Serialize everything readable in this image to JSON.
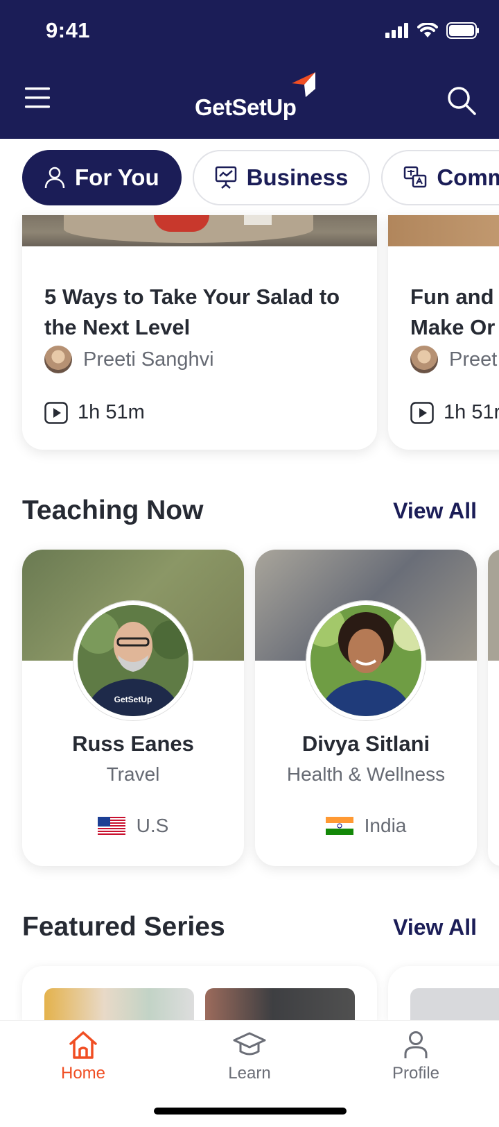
{
  "status_bar": {
    "time": "9:41"
  },
  "header": {
    "logo_text": "GetSetUp",
    "menu_icon": "hamburger-icon",
    "search_icon": "search-icon",
    "brand_color": "#1b1d57",
    "accent_color": "#f04e23"
  },
  "tabs": [
    {
      "label": "For You",
      "icon": "person-icon",
      "active": true
    },
    {
      "label": "Business",
      "icon": "presentation-chart-icon",
      "active": false
    },
    {
      "label": "Comm",
      "icon": "translate-chat-icon",
      "active": false
    }
  ],
  "lessons": [
    {
      "title": "5 Ways to Take Your Salad to the Next Level",
      "author": "Preeti Sanghvi",
      "duration": "1h 51m"
    },
    {
      "title": "Fun and Make Or",
      "title_line1": "Fun and",
      "title_line2": "Make Or",
      "author": "Preet",
      "duration": "1h 51r"
    }
  ],
  "teaching_now": {
    "title": "Teaching Now",
    "view_all": "View All",
    "teachers": [
      {
        "name": "Russ Eanes",
        "topic": "Travel",
        "country": "U.S",
        "shirt_text": "GetSetUp"
      },
      {
        "name": "Divya Sitlani",
        "topic": "Health & Wellness",
        "country": "India"
      }
    ]
  },
  "featured_series": {
    "title": "Featured Series",
    "view_all": "View All"
  },
  "bottom_nav": [
    {
      "label": "Home",
      "icon": "home-icon",
      "active": true
    },
    {
      "label": "Learn",
      "icon": "graduation-cap-icon",
      "active": false
    },
    {
      "label": "Profile",
      "icon": "profile-icon",
      "active": false
    }
  ]
}
